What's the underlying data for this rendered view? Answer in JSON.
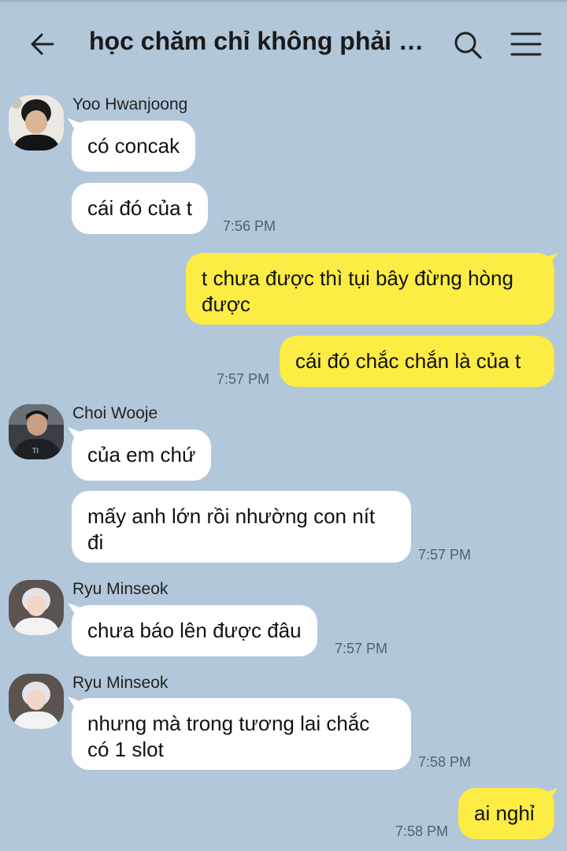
{
  "header": {
    "title": "học chăm chỉ không phải v...",
    "back_icon": "arrow-left-icon",
    "search_icon": "search-icon",
    "menu_icon": "hamburger-menu-icon"
  },
  "colors": {
    "background": "#b2c7da",
    "incoming_bubble": "#ffffff",
    "outgoing_bubble": "#fcec43"
  },
  "messages": [
    {
      "sender": "Yoo Hwanjoong",
      "direction": "in",
      "text": "có concak"
    },
    {
      "direction": "in",
      "text": "cái đó của t",
      "time": "7:56 PM"
    },
    {
      "direction": "out",
      "line1": "t chưa được thì tụi bây đừng hòng",
      "line2": "được"
    },
    {
      "direction": "out",
      "text": "cái đó chắc chắn là của t",
      "time": "7:57 PM"
    },
    {
      "sender": "Choi Wooje",
      "direction": "in",
      "text": "của em chứ"
    },
    {
      "direction": "in",
      "line1": "mấy anh lớn rồi nhường con nít",
      "line2": "đi",
      "time": "7:57 PM"
    },
    {
      "sender": "Ryu Minseok",
      "direction": "in",
      "text": "chưa báo lên được đâu",
      "time": "7:57 PM"
    },
    {
      "sender": "Ryu Minseok",
      "direction": "in",
      "line1": "nhưng mà trong tương lai chắc",
      "line2": "có 1 slot",
      "time": "7:58 PM"
    },
    {
      "direction": "out",
      "text": "ai nghỉ",
      "time": "7:58 PM"
    }
  ]
}
